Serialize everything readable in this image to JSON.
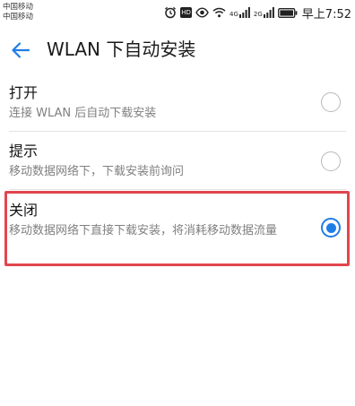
{
  "status_bar": {
    "carrier_1": "中国移动",
    "carrier_2": "中国移动",
    "hd_badge": "HD",
    "signal_1_label": "4G",
    "signal_2_label": "2G",
    "time": "早上7:52",
    "icons": [
      "alarm-icon",
      "hd-icon",
      "eye-icon",
      "wifi-icon",
      "signal-icon",
      "signal-icon",
      "battery-icon"
    ]
  },
  "app_bar": {
    "title": "WLAN 下自动安装",
    "back_icon": "back-arrow-icon"
  },
  "options": [
    {
      "label": "打开",
      "description": "连接 WLAN 后自动下载安装",
      "selected": false
    },
    {
      "label": "提示",
      "description": "移动数据网络下，下载安装前询问",
      "selected": false
    },
    {
      "label": "关闭",
      "description": "移动数据网络下直接下载安装，将消耗移动数据流量",
      "selected": true
    }
  ],
  "colors": {
    "accent": "#1e7ee6",
    "highlight_border": "#e1464f",
    "secondary_text": "#808080"
  }
}
